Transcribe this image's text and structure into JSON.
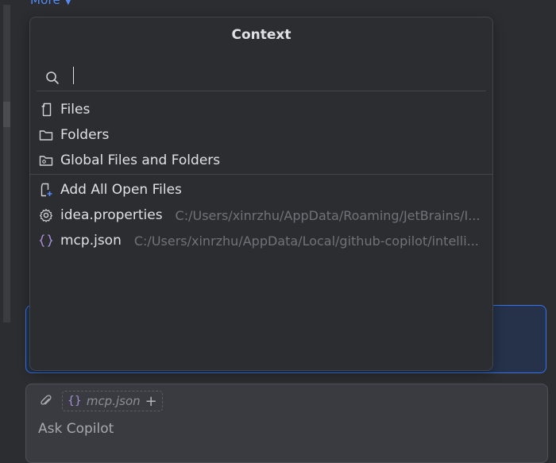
{
  "top": {
    "more_label": "More"
  },
  "popup": {
    "title": "Context",
    "search": {
      "value": "",
      "placeholder": ""
    },
    "sections": {
      "sources": [
        {
          "label": "Files",
          "icon": "file-icon"
        },
        {
          "label": "Folders",
          "icon": "folder-icon"
        },
        {
          "label": "Global Files and Folders",
          "icon": "global-folder-icon"
        }
      ],
      "files": [
        {
          "label": "Add All Open Files",
          "icon": "add-files-icon",
          "path": ""
        },
        {
          "label": "idea.properties",
          "icon": "gear-icon",
          "path": "C:/Users/xinrzhu/AppData/Roaming/JetBrains/I..."
        },
        {
          "label": "mcp.json",
          "icon": "json-icon",
          "path": "C:/Users/xinrzhu/AppData/Local/github-copilot/intelli..."
        }
      ]
    }
  },
  "input": {
    "attached_chip": "mcp.json",
    "placeholder": "Ask Copilot"
  },
  "colors": {
    "background": "#2b2d30",
    "accent": "#3574f0",
    "json_braces": "#a98fd8"
  }
}
